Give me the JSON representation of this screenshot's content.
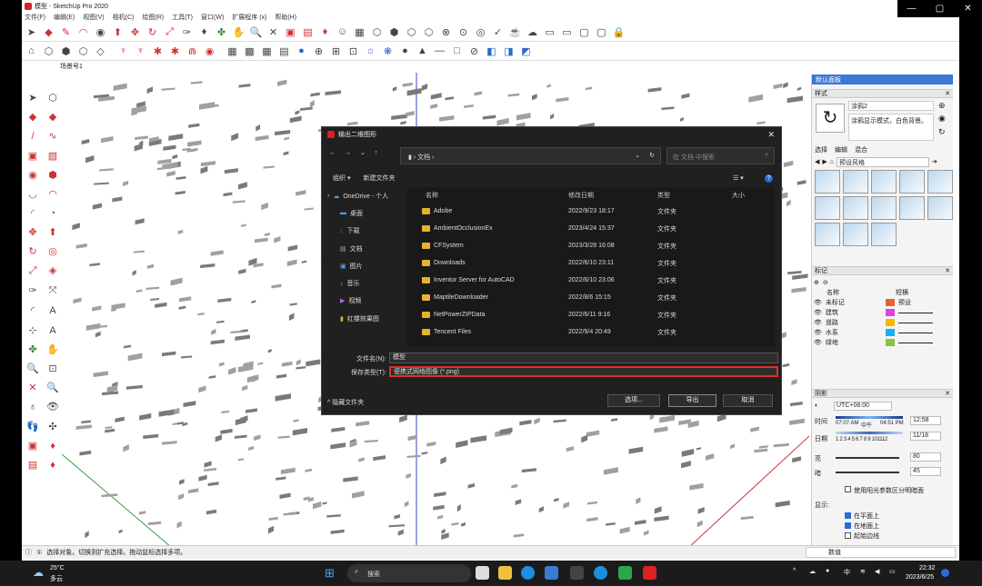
{
  "window": {
    "title": "模型 - SketchUp Pro 2020",
    "minimize": "—",
    "maximize": "▢",
    "close": "✕"
  },
  "menu": [
    "文件(F)",
    "编辑(E)",
    "视图(V)",
    "相机(C)",
    "绘图(R)",
    "工具(T)",
    "窗口(W)",
    "扩展程序 (x)",
    "帮助(H)"
  ],
  "scene_tab": "场景号1",
  "status": {
    "text": "选择对象。切换到扩充选择。拖动鼠标选择多项。",
    "value_label": "数值"
  },
  "tray": {
    "title": "默认面板",
    "styles": {
      "header": "样式",
      "name": "涂鸦2",
      "desc": "涂鸦显示模式，白色背景。",
      "tabs": [
        "选择",
        "编辑",
        "混合"
      ],
      "dropdown": "预设风格"
    },
    "tags": {
      "header": "标记",
      "col_name": "名称",
      "col_dash": "短横",
      "rows": [
        {
          "name": "未标记",
          "color": "#e8603c",
          "dash": "预设"
        },
        {
          "name": "建筑",
          "color": "#e040e0",
          "dash": ""
        },
        {
          "name": "道路",
          "color": "#f5b800",
          "dash": ""
        },
        {
          "name": "水系",
          "color": "#1ab0f0",
          "dash": ""
        },
        {
          "name": "绿地",
          "color": "#8bc34a",
          "dash": ""
        }
      ]
    },
    "shadows": {
      "header": "阴影",
      "tz": "UTC+08:00",
      "time_label": "时间",
      "time_start": "07:07 AM",
      "time_mid": "中午",
      "time_end": "04:51 PM",
      "time_value": "12:58",
      "date_label": "日期",
      "months": "1 2 3 4 5 6 7 8 9 101112",
      "date_value": "11/18",
      "light_label": "亮",
      "light_value": "80",
      "dark_label": "暗",
      "dark_value": "45",
      "sun_option": "使用阳光参数区分明暗面",
      "display_label": "显示:",
      "on_face": "在平面上",
      "on_ground": "在地面上",
      "from_edges": "起始边线"
    }
  },
  "dialog": {
    "title": "输出二维图形",
    "breadcrumb": "文档",
    "search_placeholder": "在 文档 中搜索",
    "organize": "组织 ▾",
    "new_folder": "新建文件夹",
    "nav": [
      "OneDrive - 个人",
      "桌面",
      "下载",
      "文档",
      "图片",
      "音乐",
      "视频",
      "红楼效果图"
    ],
    "columns": [
      "名称",
      "修改日期",
      "类型",
      "大小"
    ],
    "files": [
      {
        "name": "Adobe",
        "date": "2022/9/23 18:17",
        "type": "文件夹"
      },
      {
        "name": "AmbientOcclusionEx",
        "date": "2023/4/24 15:37",
        "type": "文件夹"
      },
      {
        "name": "CFSystem",
        "date": "2023/3/28 16:08",
        "type": "文件夹"
      },
      {
        "name": "Downloads",
        "date": "2022/6/10 23:11",
        "type": "文件夹"
      },
      {
        "name": "Inventor Server for AutoCAD",
        "date": "2022/6/10 23:06",
        "type": "文件夹"
      },
      {
        "name": "MaptileDownloader",
        "date": "2022/8/6 15:15",
        "type": "文件夹"
      },
      {
        "name": "NetPowerZIPData",
        "date": "2022/6/11 9:16",
        "type": "文件夹"
      },
      {
        "name": "Tencent Files",
        "date": "2022/9/4 20:49",
        "type": "文件夹"
      }
    ],
    "filename_label": "文件名(N):",
    "filename_value": "模型",
    "filetype_label": "保存类型(T):",
    "filetype_value": "便携式网络图像 (*.png)",
    "hide_folders": "隐藏文件夹",
    "options_btn": "选项...",
    "export_btn": "导出",
    "cancel_btn": "取消"
  },
  "taskbar": {
    "weather_temp": "25°C",
    "weather_desc": "多云",
    "search": "搜索",
    "time": "22:32",
    "date": "2023/6/25",
    "ime": "中"
  }
}
